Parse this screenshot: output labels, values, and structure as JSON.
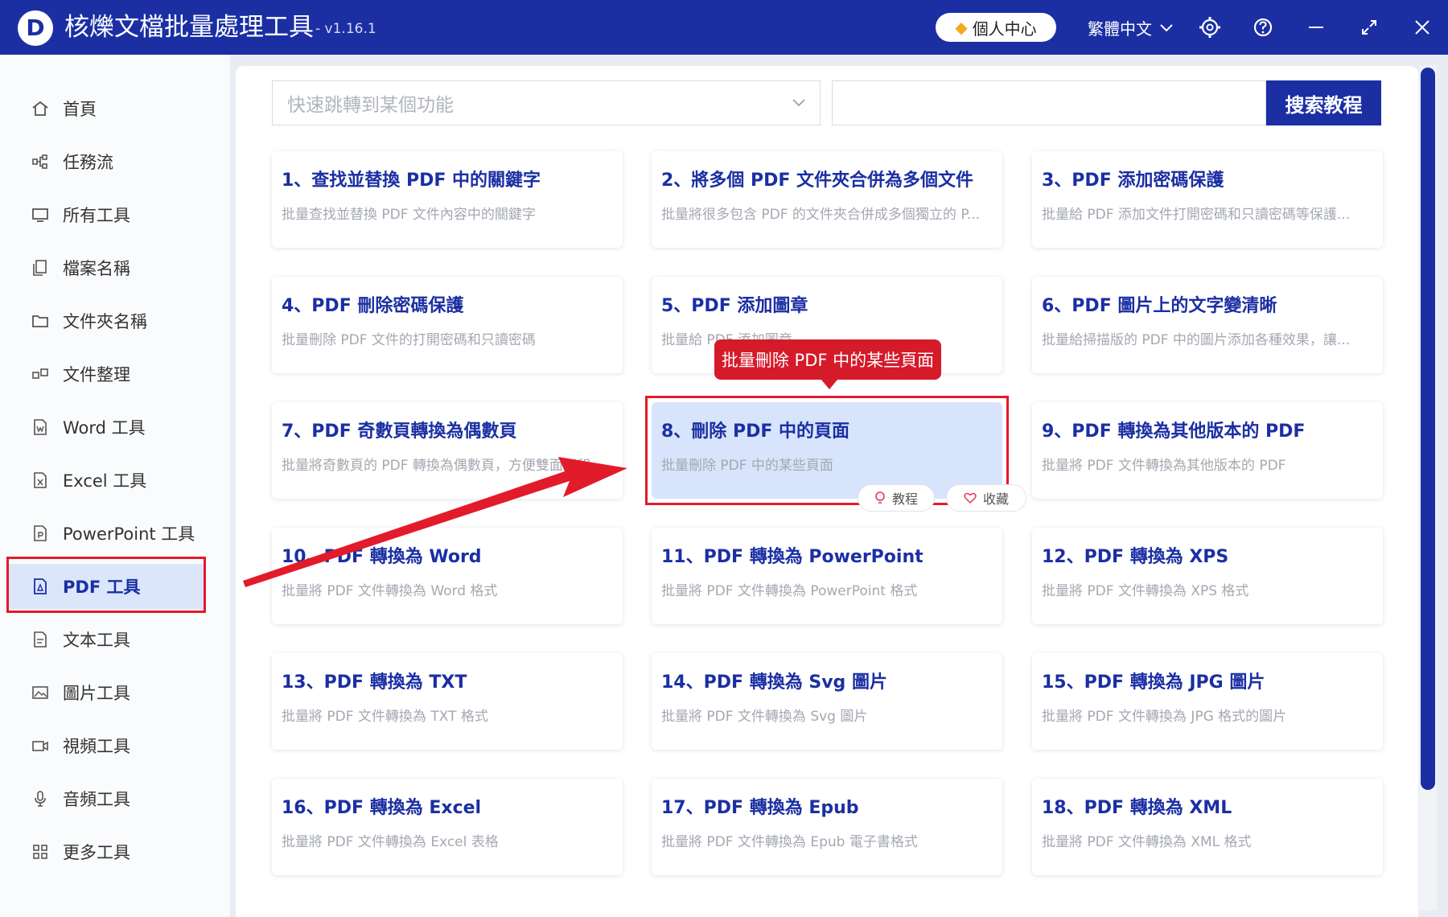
{
  "app": {
    "title": "核爍文檔批量處理工具",
    "version": "- v1.16.1",
    "user_center": "個人中心",
    "language": "繁體中文"
  },
  "icons": {
    "window": [
      "settings-icon",
      "help-icon",
      "minimize-icon",
      "maximize-icon",
      "close-icon"
    ]
  },
  "sidebar": {
    "items": [
      {
        "label": "首頁",
        "icon": "home-icon"
      },
      {
        "label": "任務流",
        "icon": "workflow-icon"
      },
      {
        "label": "所有工具",
        "icon": "monitor-icon"
      },
      {
        "label": "檔案名稱",
        "icon": "file-copy-icon"
      },
      {
        "label": "文件夾名稱",
        "icon": "folder-icon"
      },
      {
        "label": "文件整理",
        "icon": "organize-icon"
      },
      {
        "label": "Word 工具",
        "icon": "word-file-icon"
      },
      {
        "label": "Excel 工具",
        "icon": "excel-file-icon"
      },
      {
        "label": "PowerPoint 工具",
        "icon": "ppt-file-icon"
      },
      {
        "label": "PDF 工具",
        "icon": "pdf-file-icon",
        "active": true
      },
      {
        "label": "文本工具",
        "icon": "text-file-icon"
      },
      {
        "label": "圖片工具",
        "icon": "image-icon"
      },
      {
        "label": "視頻工具",
        "icon": "video-icon"
      },
      {
        "label": "音頻工具",
        "icon": "microphone-icon"
      },
      {
        "label": "更多工具",
        "icon": "grid-icon"
      }
    ]
  },
  "toolbar": {
    "jump_placeholder": "快速跳轉到某個功能",
    "search_button": "搜索教程"
  },
  "cards": [
    {
      "title": "1、查找並替換 PDF 中的關鍵字",
      "desc": "批量查找並替換 PDF 文件內容中的關鍵字"
    },
    {
      "title": "2、將多個 PDF 文件夾合併為多個文件",
      "desc": "批量將很多包含 PDF 的文件夾合併成多個獨立的 P..."
    },
    {
      "title": "3、PDF 添加密碼保護",
      "desc": "批量給 PDF 添加文件打開密碼和只讀密碼等保護..."
    },
    {
      "title": "4、PDF 刪除密碼保護",
      "desc": "批量刪除 PDF 文件的打開密碼和只讀密碼"
    },
    {
      "title": "5、PDF 添加圖章",
      "desc": "批量給 PDF 添加圖章"
    },
    {
      "title": "6、PDF 圖片上的文字變清晰",
      "desc": "批量給掃描版的 PDF 中的圖片添加各種效果，讓..."
    },
    {
      "title": "7、PDF 奇數頁轉換為偶數頁",
      "desc": "批量將奇數頁的 PDF 轉換為偶數頁，方便雙面打印"
    },
    {
      "title": "8、刪除 PDF 中的頁面",
      "desc": "批量刪除 PDF 中的某些頁面",
      "highlighted": true
    },
    {
      "title": "9、PDF 轉換為其他版本的 PDF",
      "desc": "批量將 PDF 文件轉換為其他版本的 PDF"
    },
    {
      "title": "10、PDF 轉換為 Word",
      "desc": "批量將 PDF 文件轉換為 Word 格式"
    },
    {
      "title": "11、PDF 轉換為 PowerPoint",
      "desc": "批量將 PDF 文件轉換為 PowerPoint 格式"
    },
    {
      "title": "12、PDF 轉換為 XPS",
      "desc": "批量將 PDF 文件轉換為 XPS 格式"
    },
    {
      "title": "13、PDF 轉換為 TXT",
      "desc": "批量將 PDF 文件轉換為 TXT 格式"
    },
    {
      "title": "14、PDF 轉換為 Svg 圖片",
      "desc": "批量將 PDF 文件轉換為 Svg 圖片"
    },
    {
      "title": "15、PDF 轉換為 JPG 圖片",
      "desc": "批量將 PDF 文件轉換為 JPG 格式的圖片"
    },
    {
      "title": "16、PDF 轉換為 Excel",
      "desc": "批量將 PDF 文件轉換為 Excel 表格"
    },
    {
      "title": "17、PDF 轉換為 Epub",
      "desc": "批量將 PDF 文件轉換為 Epub 電子書格式"
    },
    {
      "title": "18、PDF 轉換為 XML",
      "desc": "批量將 PDF 文件轉換為 XML 格式"
    }
  ],
  "card_actions": {
    "tutorial": "教程",
    "favorite": "收藏"
  },
  "tooltip": "批量刪除 PDF 中的某些頁面",
  "colors": {
    "brand": "#1b2fa3",
    "highlight": "#e21b2a",
    "card_selected": "#d7e4fb"
  }
}
